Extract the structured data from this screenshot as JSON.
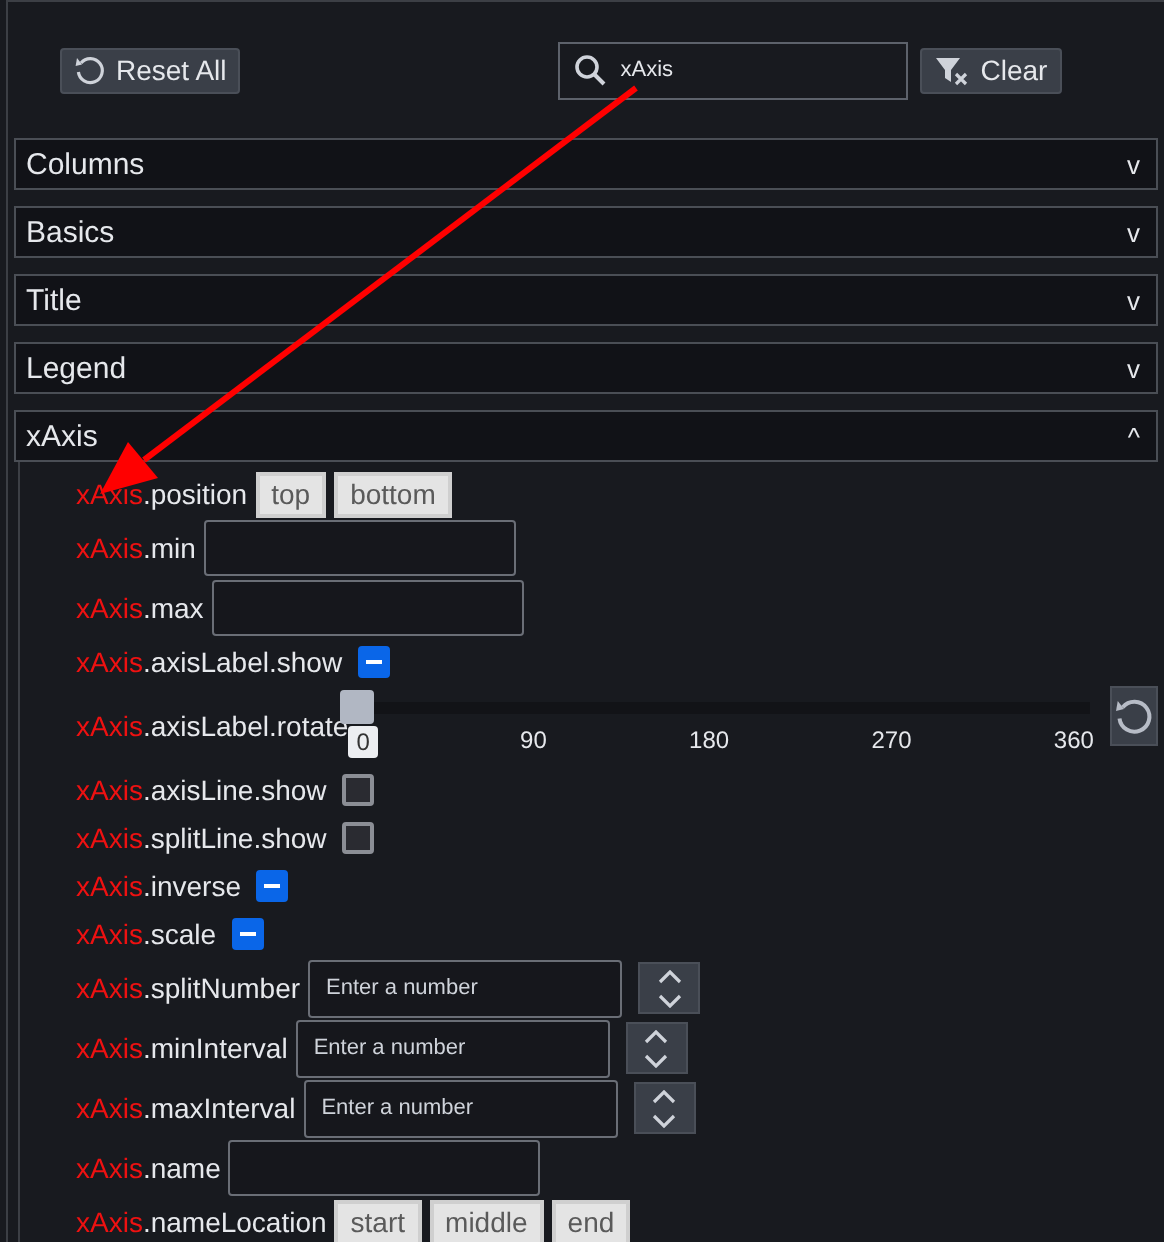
{
  "toolbar": {
    "reset_label": "Reset All",
    "search": {
      "value": "xAxis"
    },
    "clear_label": "Clear"
  },
  "sections": [
    {
      "title": "Columns",
      "toggle": "v"
    },
    {
      "title": "Basics",
      "toggle": "v"
    },
    {
      "title": "Title",
      "toggle": "v"
    },
    {
      "title": "Legend",
      "toggle": "v"
    },
    {
      "title": "xAxis",
      "toggle": "^",
      "settings": [
        {
          "kind": "segmented",
          "match": "xAxis",
          "rest": ".position",
          "options": [
            {
              "label": "top",
              "selected": false
            },
            {
              "label": "bottom",
              "selected": false
            }
          ]
        },
        {
          "kind": "text",
          "match": "xAxis",
          "rest": ".min"
        },
        {
          "kind": "text",
          "match": "xAxis",
          "rest": ".max"
        },
        {
          "kind": "checkbox",
          "match": "xAxis",
          "rest": ".axisLabel.show",
          "checked": true
        },
        {
          "kind": "slider",
          "match": "xAxis",
          "rest": ".axisLabel.rotate",
          "level": 0,
          "value": "0",
          "ticks": [
            "90",
            "180",
            "270",
            "360"
          ]
        },
        {
          "kind": "checkbox",
          "match": "xAxis",
          "rest": ".axisLine.show",
          "checked": false
        },
        {
          "kind": "checkbox",
          "match": "xAxis",
          "rest": ".splitLine.show",
          "checked": false
        },
        {
          "kind": "checkbox",
          "match": "xAxis",
          "rest": ".inverse",
          "checked": true
        },
        {
          "kind": "checkbox",
          "match": "xAxis",
          "rest": ".scale",
          "checked": true
        },
        {
          "kind": "number",
          "match": "xAxis",
          "rest": ".splitNumber",
          "placeholder": "Enter a number"
        },
        {
          "kind": "number",
          "match": "xAxis",
          "rest": ".minInterval",
          "placeholder": "Enter a number"
        },
        {
          "kind": "number",
          "match": "xAxis",
          "rest": ".maxInterval",
          "placeholder": "Enter a number"
        },
        {
          "kind": "text",
          "match": "xAxis",
          "rest": ".name"
        },
        {
          "kind": "segmented",
          "match": "xAxis",
          "rest": ".nameLocation",
          "options": [
            {
              "label": "start",
              "selected": false
            },
            {
              "label": "middle",
              "selected": false
            },
            {
              "label": "end",
              "selected": false
            }
          ]
        }
      ]
    }
  ]
}
